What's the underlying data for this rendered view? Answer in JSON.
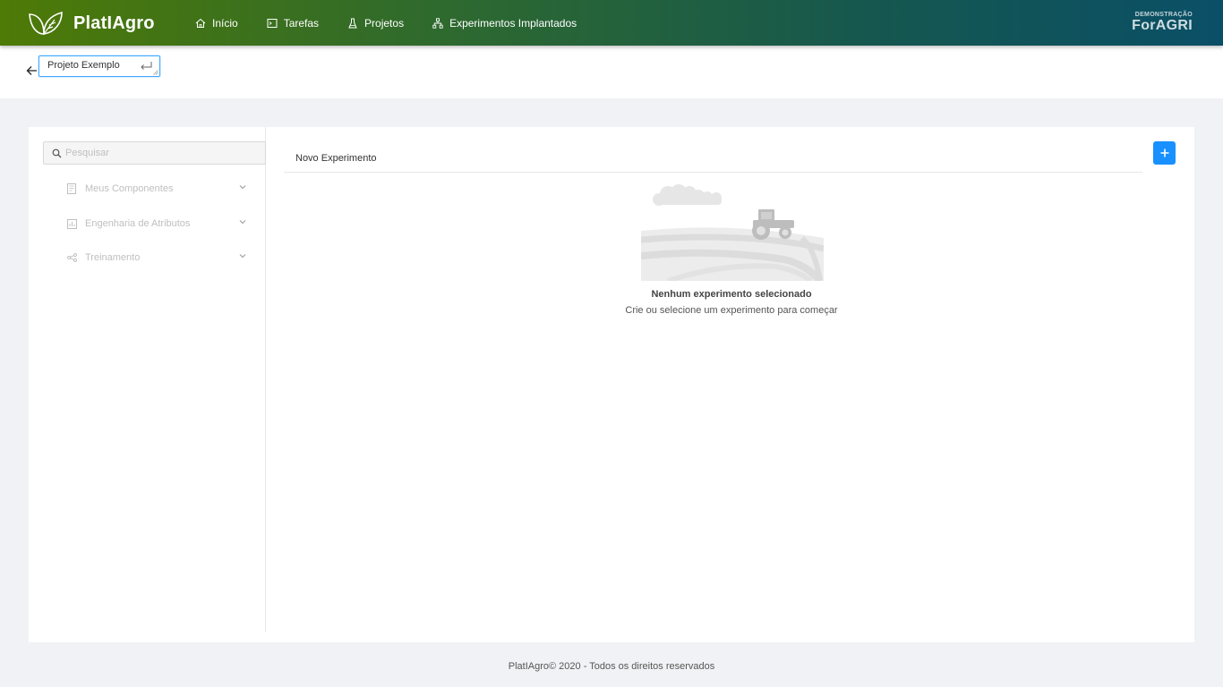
{
  "app": {
    "logo_text": "PlatIAgro",
    "brand_small": "DEMONSTRAÇÃO",
    "brand_big": "ForAGRI"
  },
  "nav": [
    {
      "label": "Início",
      "icon": "home-icon"
    },
    {
      "label": "Tarefas",
      "icon": "terminal-icon"
    },
    {
      "label": "Projetos",
      "icon": "flask-icon"
    },
    {
      "label": "Experimentos Implantados",
      "icon": "cluster-icon"
    }
  ],
  "project": {
    "name": "Projeto Exemplo"
  },
  "sidebar": {
    "search_placeholder": "Pesquisar",
    "items": [
      {
        "label": "Meus Componentes",
        "icon": "file-icon"
      },
      {
        "label": "Engenharia de Atributos",
        "icon": "chart-box-icon"
      },
      {
        "label": "Treinamento",
        "icon": "share-nodes-icon"
      }
    ]
  },
  "experiments": {
    "tab_label": "Novo Experimento",
    "add_icon": "plus-icon"
  },
  "empty_state": {
    "title": "Nenhum experimento selecionado",
    "subtitle": "Crie ou selecione um experimento para começar"
  },
  "footer": {
    "text": "PlatIAgro© 2020 - Todos os direitos reservados"
  },
  "colors": {
    "header_start": "#4e7a06",
    "header_end": "#0a4f67",
    "accent": "#1890ff"
  }
}
